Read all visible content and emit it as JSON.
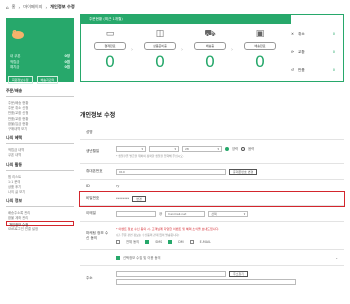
{
  "breadcrumb": [
    "홈",
    "마이페이지",
    "개인정보 수정"
  ],
  "profile": {
    "stats": [
      {
        "label": "내 쿠폰",
        "value": "0장"
      },
      {
        "label": "적립금",
        "value": "0원"
      },
      {
        "label": "예치금",
        "value": "0원"
      }
    ],
    "buttons": [
      "회원정보수정",
      "배송지관리"
    ]
  },
  "sidebar": [
    {
      "heading": "주문/배송",
      "items": [
        "주문/배송 현황",
        "주문 취소 신청",
        "반품/교환 신청",
        "반품/교환 현황",
        "환불/입금 현황",
        "구매내역 보기"
      ]
    },
    {
      "heading": "나의 혜택",
      "items": [
        "적립금 내역",
        "쿠폰 내역"
      ]
    },
    {
      "heading": "나의 활동",
      "items": [
        "찜 리스트",
        "1:1 문의",
        "상품 후기",
        "나의 글 보기"
      ]
    },
    {
      "heading": "나의 정보",
      "items": [
        "배송주소록 관리",
        "환불 계좌 관리",
        "개인정보 수정",
        "SNS로그인 연결 설정"
      ]
    }
  ],
  "order_status": {
    "title": "주문현황 (최근 1개월)",
    "steps": [
      {
        "label": "결제완료",
        "count": "0"
      },
      {
        "label": "상품준비중",
        "count": "0"
      },
      {
        "label": "배송중",
        "count": "0"
      },
      {
        "label": "배송완료",
        "count": "0"
      }
    ],
    "side": [
      {
        "label": "취소",
        "count": "0"
      },
      {
        "label": "교환",
        "count": "0"
      },
      {
        "label": "반품",
        "count": "0"
      }
    ]
  },
  "form": {
    "title": "개인정보 수정",
    "name_label": "성명",
    "birth_label": "생년월일",
    "birth_day": "28",
    "birth_note": "* 생일쿠폰 발급을 위하여 정확한 생일을 입력해 주십시오.",
    "gender": [
      "양력",
      "음력"
    ],
    "phone_label": "휴대폰번호",
    "phone_value": "010",
    "phone_button": "휴대폰번호 변경",
    "id_label": "ID",
    "id_value": "ry",
    "pw_label": "비밀번호",
    "pw_value": "********",
    "pw_button": "변경",
    "email_label": "이메일",
    "email_at": "@",
    "email_domain": "hanmail.net",
    "email_select": "선택",
    "marketing_label": "마케팅 정보 수신 동의",
    "marketing_note": "* 이벤트 정보 수신 동의 시, 고객님께 다양한 이벤트 및 혜택 소식을 보내드립니다.",
    "marketing_note2": "(단, 주문 관련 정보는 수신동의 관계 없이 발송됩니다)",
    "marketing_options": [
      "전체 동의",
      "SMS",
      "DM",
      "E-MAIL"
    ],
    "privacy_label": "선택정보 수집 및 이용 동의",
    "address_label": "주소",
    "address_zip": "",
    "address_button": "주소찾기"
  }
}
